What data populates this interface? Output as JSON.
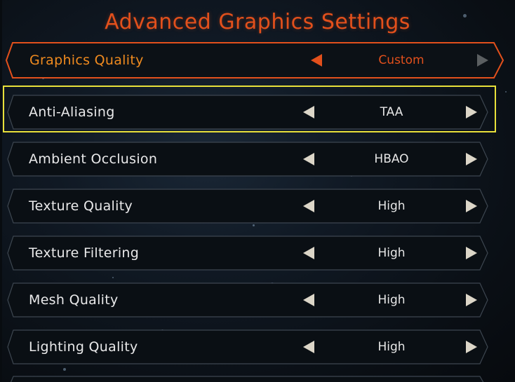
{
  "screen_title": "Advanced Graphics Settings",
  "colors": {
    "title": "#e2501c",
    "primary_label": "#ef8a1f",
    "primary_value": "#e2501c",
    "selection_outline": "#e8e03a",
    "row_border": "#3d4650",
    "arrow": "#dcd6c8",
    "arrow_disabled": "#5b5f61"
  },
  "icons": {
    "left": "arrow-left-icon",
    "right": "arrow-right-icon"
  },
  "settings": [
    {
      "label": "Graphics Quality",
      "value": "Custom"
    },
    {
      "label": "Anti-Aliasing",
      "value": "TAA"
    },
    {
      "label": "Ambient Occlusion",
      "value": "HBAO"
    },
    {
      "label": "Texture Quality",
      "value": "High"
    },
    {
      "label": "Texture Filtering",
      "value": "High"
    },
    {
      "label": "Mesh Quality",
      "value": "High"
    },
    {
      "label": "Lighting Quality",
      "value": "High"
    }
  ],
  "selected_setting": "Anti-Aliasing"
}
